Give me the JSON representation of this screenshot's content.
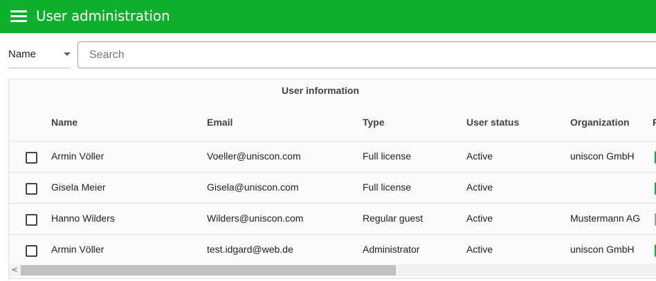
{
  "app": {
    "title": "User administration"
  },
  "filter": {
    "field_label": "Name",
    "search_placeholder": "Search",
    "search_value": ""
  },
  "table": {
    "group_title": "User information",
    "columns": [
      "Name",
      "Email",
      "Type",
      "User status",
      "Organization",
      "F"
    ],
    "rows": [
      {
        "name": "Armin Völler",
        "email": "Voeller@uniscon.com",
        "type": "Full license",
        "status": "Active",
        "organization": "uniscon GmbH",
        "tag_color": "#0db02b"
      },
      {
        "name": "Gisela Meier",
        "email": "Gisela@uniscon.com",
        "type": "Full license",
        "status": "Active",
        "organization": "",
        "tag_color": "#0db02b"
      },
      {
        "name": "Hanno Wilders",
        "email": "Wilders@uniscon.com",
        "type": "Regular guest",
        "status": "Active",
        "organization": "Mustermann AG",
        "tag_color": "#9e9e9e"
      },
      {
        "name": "Armin Völler",
        "email": "test.idgard@web.de",
        "type": "Administrator",
        "status": "Active",
        "organization": "uniscon GmbH",
        "tag_color": "#0db02b"
      }
    ]
  },
  "scrollbar": {
    "left_arrow": "<",
    "position": 0.0,
    "visible_fraction": 0.59
  },
  "colors": {
    "brand": "#0db02b",
    "text": "#212121",
    "header_text": "#424242",
    "divider": "#e0e0e0"
  }
}
